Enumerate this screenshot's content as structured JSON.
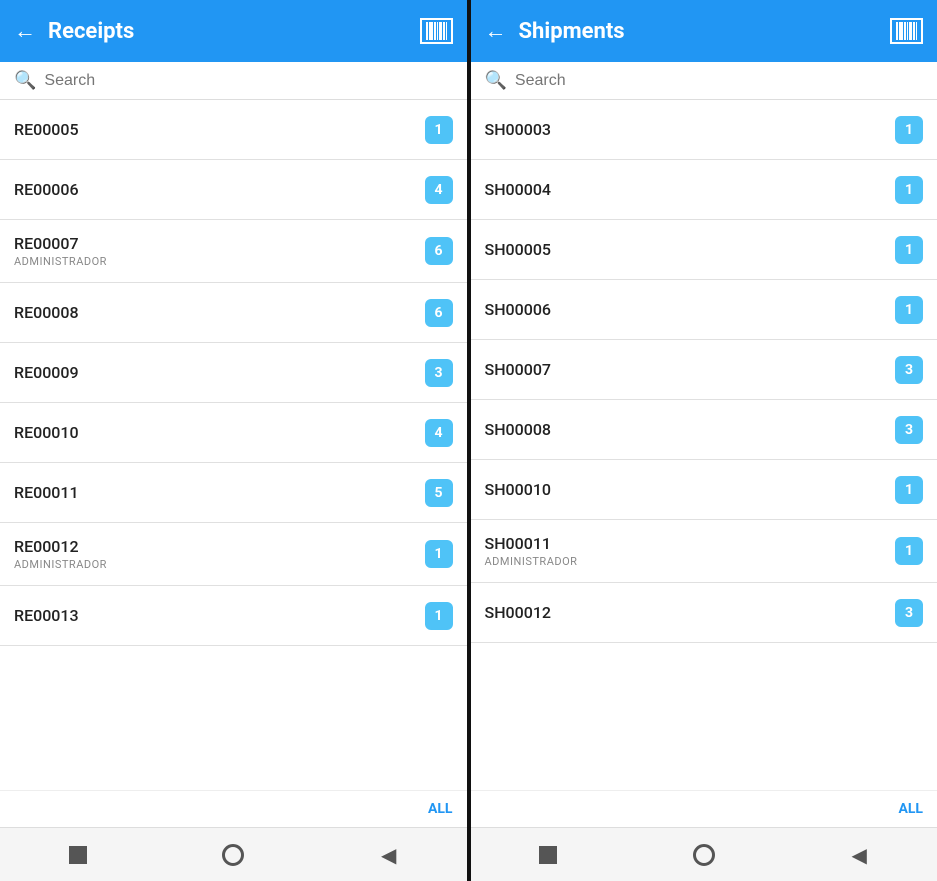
{
  "left_panel": {
    "title": "Receipts",
    "search_placeholder": "Search",
    "footer_label": "ALL",
    "items": [
      {
        "id": "RE00005",
        "sub": "",
        "badge": "1"
      },
      {
        "id": "RE00006",
        "sub": "",
        "badge": "4"
      },
      {
        "id": "RE00007",
        "sub": "ADMINISTRADOR",
        "badge": "6"
      },
      {
        "id": "RE00008",
        "sub": "",
        "badge": "6"
      },
      {
        "id": "RE00009",
        "sub": "",
        "badge": "3"
      },
      {
        "id": "RE00010",
        "sub": "",
        "badge": "4"
      },
      {
        "id": "RE00011",
        "sub": "",
        "badge": "5"
      },
      {
        "id": "RE00012",
        "sub": "ADMINISTRADOR",
        "badge": "1"
      },
      {
        "id": "RE00013",
        "sub": "",
        "badge": "1"
      }
    ]
  },
  "right_panel": {
    "title": "Shipments",
    "search_placeholder": "Search",
    "footer_label": "ALL",
    "items": [
      {
        "id": "SH00003",
        "sub": "",
        "badge": "1"
      },
      {
        "id": "SH00004",
        "sub": "",
        "badge": "1"
      },
      {
        "id": "SH00005",
        "sub": "",
        "badge": "1"
      },
      {
        "id": "SH00006",
        "sub": "",
        "badge": "1"
      },
      {
        "id": "SH00007",
        "sub": "",
        "badge": "3"
      },
      {
        "id": "SH00008",
        "sub": "",
        "badge": "3"
      },
      {
        "id": "SH00010",
        "sub": "",
        "badge": "1"
      },
      {
        "id": "SH00011",
        "sub": "ADMINISTRADOR",
        "badge": "1"
      },
      {
        "id": "SH00012",
        "sub": "",
        "badge": "3"
      }
    ]
  },
  "nav": {
    "square": "■",
    "back": "◀"
  }
}
